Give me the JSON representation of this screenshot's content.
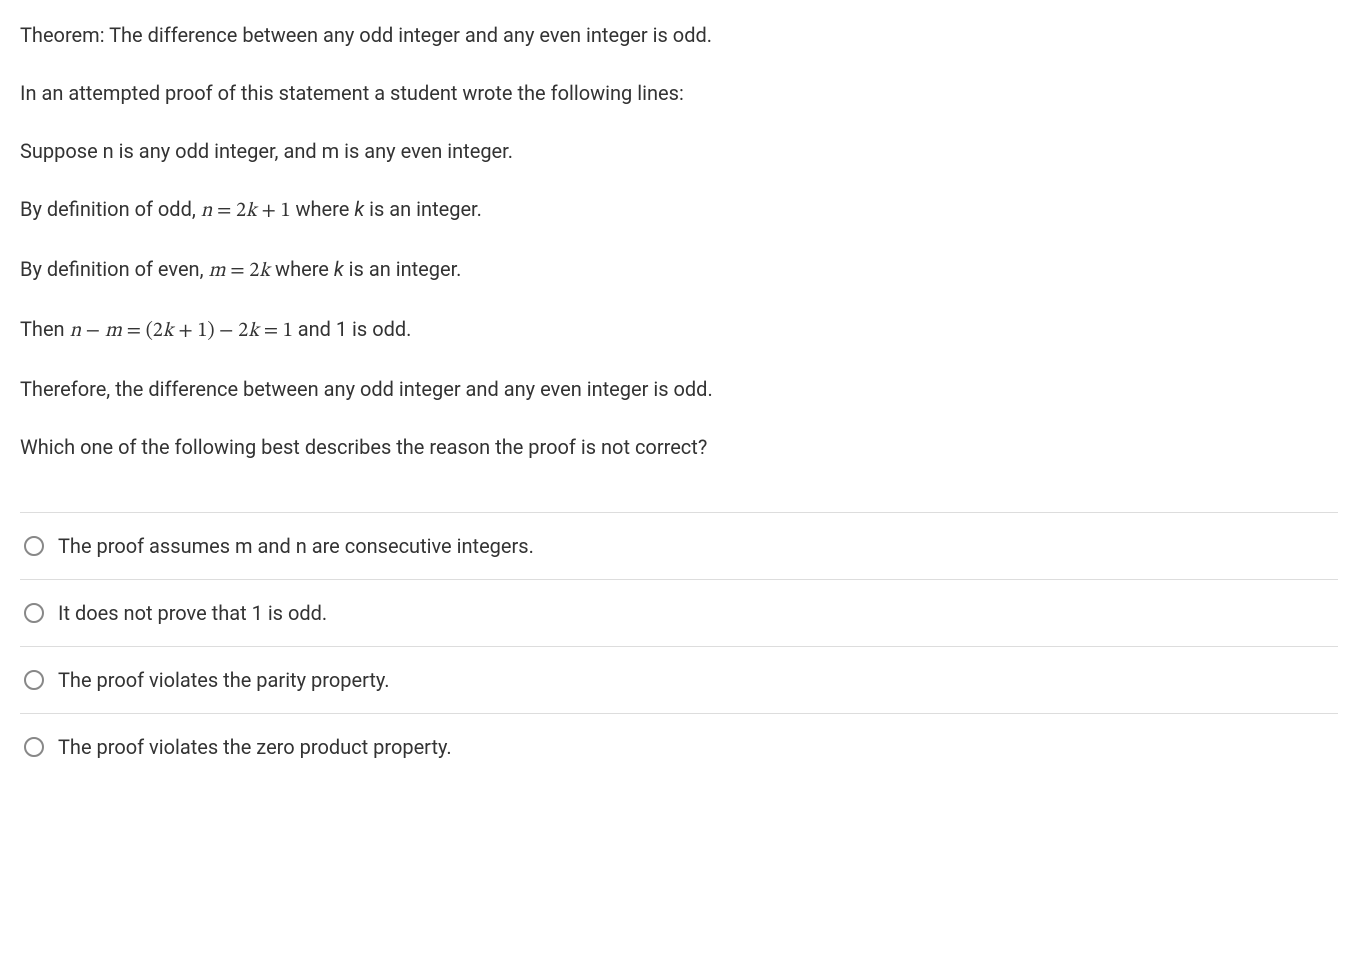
{
  "question": {
    "p1": "Theorem: The difference between any odd integer and any even integer is odd.",
    "p2": "In an attempted proof of this statement a student wrote the following lines:",
    "p3": "Suppose n is any odd integer, and m is any even integer.",
    "p4_pre": "By definition of odd, ",
    "p4_math": "n = 2k + 1",
    "p4_post_a": " where ",
    "p4_post_var": "k",
    "p4_post_b": " is an integer.",
    "p5_pre": "By definition of even, ",
    "p5_math": "m = 2k",
    "p5_post_a": " where ",
    "p5_post_var": "k",
    "p5_post_b": " is an integer.",
    "p6_pre": "Then ",
    "p6_math": "n − m = (2k + 1) − 2k = 1",
    "p6_post": " and 1 is odd.",
    "p7": "Therefore, the difference between any odd integer and any even integer is odd.",
    "p8": "Which one of the following best describes the reason the proof is not correct?"
  },
  "options": [
    {
      "label": "The proof assumes m and n are consecutive integers."
    },
    {
      "label": "It does not prove that 1 is odd."
    },
    {
      "label": "The proof violates the parity property."
    },
    {
      "label": "The proof violates the zero product property."
    }
  ]
}
